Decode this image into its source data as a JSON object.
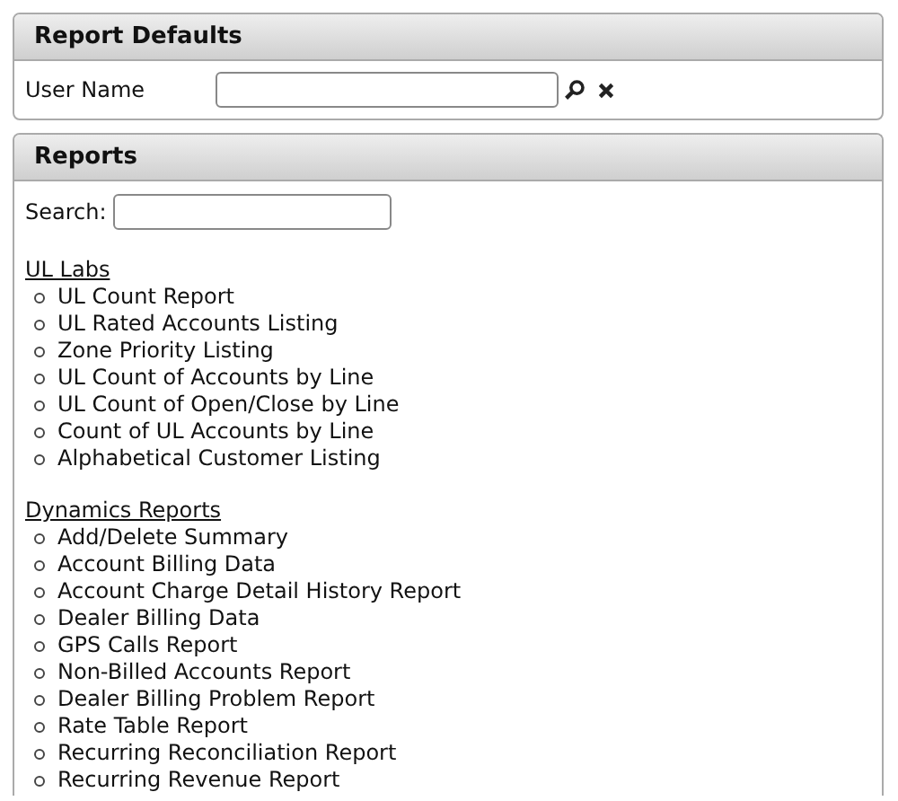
{
  "report_defaults": {
    "title": "Report Defaults",
    "user_name": {
      "label": "User Name"
    }
  },
  "reports": {
    "title": "Reports",
    "search": {
      "label": "Search:"
    },
    "groups": [
      {
        "title": "UL Labs",
        "items": [
          "UL Count Report",
          "UL Rated Accounts Listing",
          "Zone Priority Listing",
          "UL Count of Accounts by Line",
          "UL Count of Open/Close by Line",
          "Count of UL Accounts by Line",
          "Alphabetical Customer Listing"
        ]
      },
      {
        "title": "Dynamics Reports",
        "items": [
          "Add/Delete Summary",
          "Account Billing Data",
          "Account Charge Detail History Report",
          "Dealer Billing Data",
          "GPS Calls Report",
          "Non-Billed Accounts Report",
          "Dealer Billing Problem Report",
          "Rate Table Report",
          "Recurring Reconciliation Report",
          "Recurring Revenue Report"
        ]
      }
    ]
  }
}
